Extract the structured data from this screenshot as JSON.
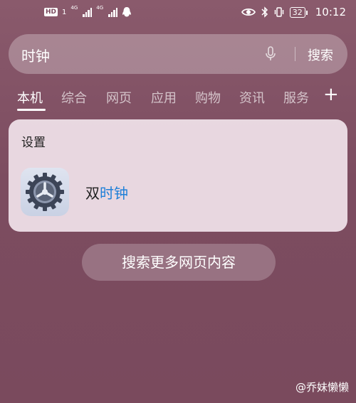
{
  "status_bar": {
    "hd_label": "HD",
    "hd_num": "1",
    "net1": "4G",
    "net2": "4G",
    "battery": "32",
    "time": "10:12"
  },
  "search": {
    "query": "时钟",
    "button_label": "搜索"
  },
  "tabs": [
    {
      "label": "本机"
    },
    {
      "label": "综合"
    },
    {
      "label": "网页"
    },
    {
      "label": "应用"
    },
    {
      "label": "购物"
    },
    {
      "label": "资讯"
    },
    {
      "label": "服务"
    }
  ],
  "tab_add": "+",
  "result_card": {
    "title": "设置",
    "app_name_prefix": "双",
    "app_name_match": "时钟"
  },
  "more_button": "搜索更多网页内容",
  "watermark": "@乔妹懒懒",
  "colors": {
    "highlight": "#1e7fd8",
    "background": "#7c4c60"
  }
}
